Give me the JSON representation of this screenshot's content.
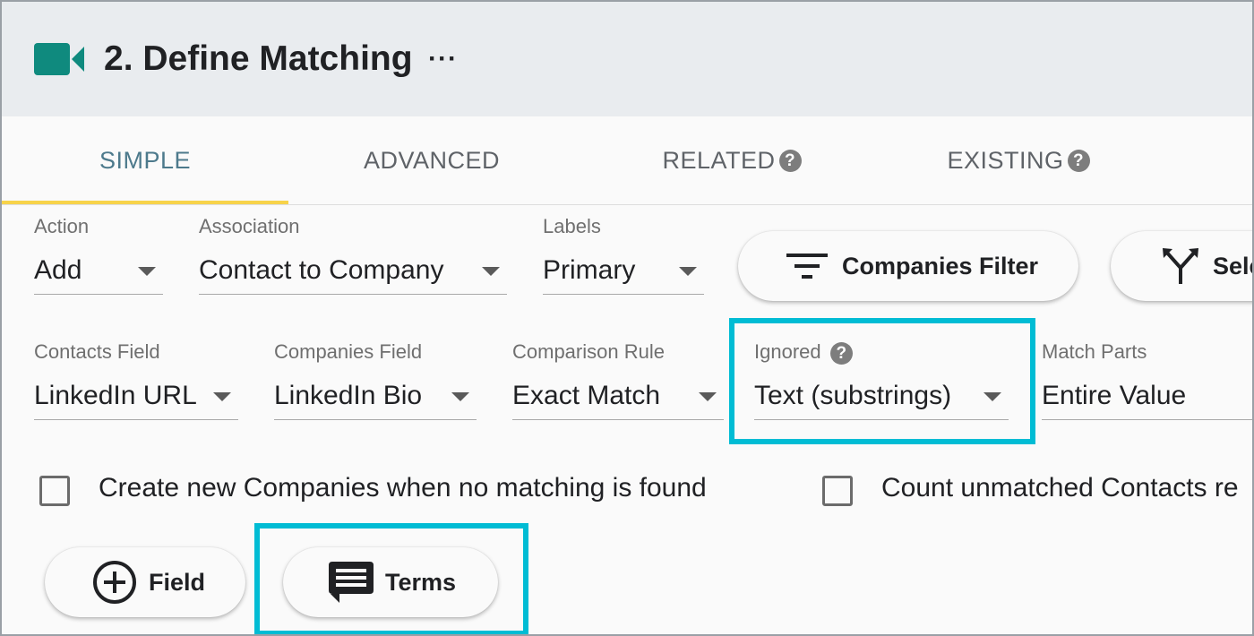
{
  "header": {
    "title": "2. Define Matching",
    "more": "···"
  },
  "tabs": [
    {
      "label": "SIMPLE",
      "active": true
    },
    {
      "label": "ADVANCED",
      "active": false
    },
    {
      "label": "RELATED",
      "active": false
    },
    {
      "label": "EXISTING",
      "active": false
    }
  ],
  "help_glyph": "?",
  "row1": {
    "action": {
      "label": "Action",
      "value": "Add"
    },
    "association": {
      "label": "Association",
      "value": "Contact to Company"
    },
    "labels": {
      "label": "Labels",
      "value": "Primary"
    },
    "companies_filter": "Companies Filter",
    "select_btn": "Sele"
  },
  "row2": {
    "contacts_field": {
      "label": "Contacts Field",
      "value": "LinkedIn URL"
    },
    "companies_field": {
      "label": "Companies Field",
      "value": "LinkedIn Bio"
    },
    "comparison_rule": {
      "label": "Comparison Rule",
      "value": "Exact Match"
    },
    "ignored": {
      "label": "Ignored",
      "value": "Text (substrings)"
    },
    "match_parts": {
      "label": "Match Parts",
      "value": "Entire Value"
    }
  },
  "checkboxes": [
    {
      "label": "Create new Companies when no matching is found",
      "checked": false
    },
    {
      "label": "Count unmatched Contacts re",
      "checked": false
    }
  ],
  "buttons": {
    "field": "Field",
    "terms": "Terms"
  },
  "colors": {
    "brand_teal": "#0f8a7e",
    "highlight": "#00bcd4",
    "tab_indicator": "#f7d34a",
    "active_tab": "#4d7a8c"
  },
  "icons": [
    "video-camera-icon",
    "more-icon",
    "help-icon",
    "filter-icon",
    "fork-icon",
    "add-circle-icon",
    "comment-icon",
    "dropdown-caret-icon"
  ]
}
